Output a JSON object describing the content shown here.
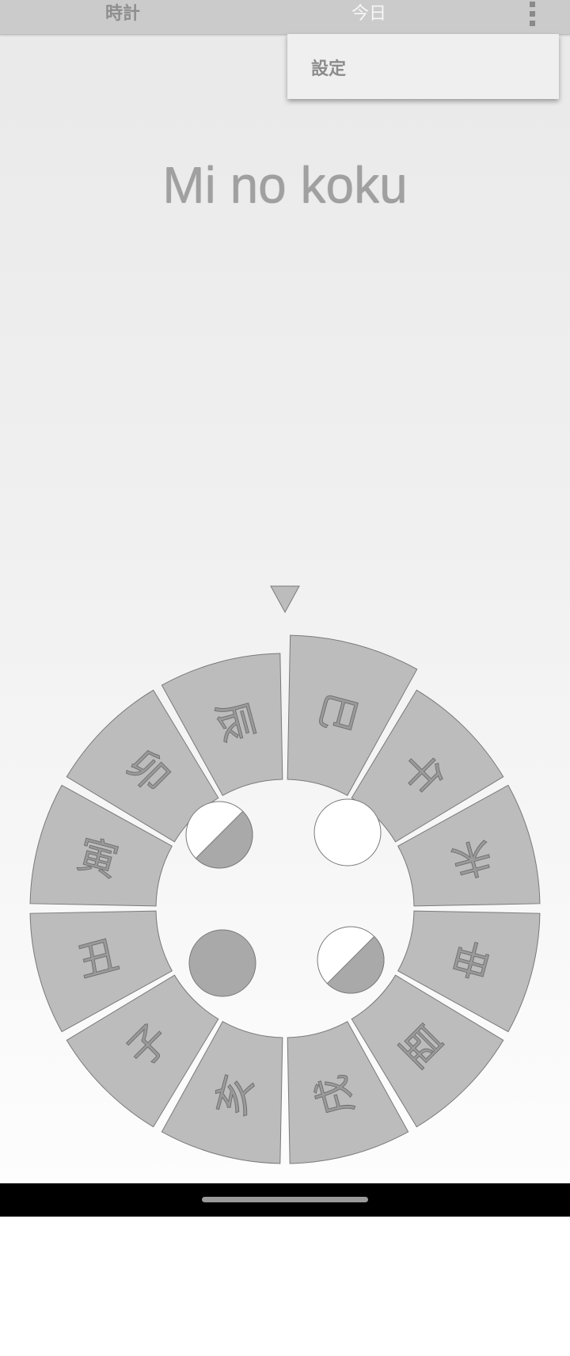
{
  "top_bar": {
    "tabs": [
      {
        "label": "時計",
        "color": "#8e8e8e"
      },
      {
        "label": "今日",
        "color": "#f7f7f7"
      }
    ],
    "overflow_icon": "more-vert-icon"
  },
  "menu": {
    "items": [
      {
        "label": "設定"
      }
    ]
  },
  "main": {
    "title": "Mi no koku"
  },
  "wheel": {
    "signs": [
      "巳",
      "午",
      "未",
      "申",
      "酉",
      "戌",
      "亥",
      "子",
      "丑",
      "寅",
      "卯",
      "辰"
    ],
    "current_sign": "巳",
    "pointer_icon": "triangle-pointer-icon",
    "moon_phases": [
      {
        "name": "waning-phase-icon",
        "position": "top-left"
      },
      {
        "name": "full-moon-phase-icon",
        "position": "top-right"
      },
      {
        "name": "new-moon-phase-icon",
        "position": "bottom-left"
      },
      {
        "name": "waxing-phase-icon",
        "position": "bottom-right"
      }
    ],
    "colors": {
      "segment_fill": "#bcbcbc",
      "segment_stroke": "#7a7a7a",
      "label_color": "#9a9a9a",
      "moon_dark": "#a9a9a9",
      "moon_light": "#ffffff"
    }
  }
}
